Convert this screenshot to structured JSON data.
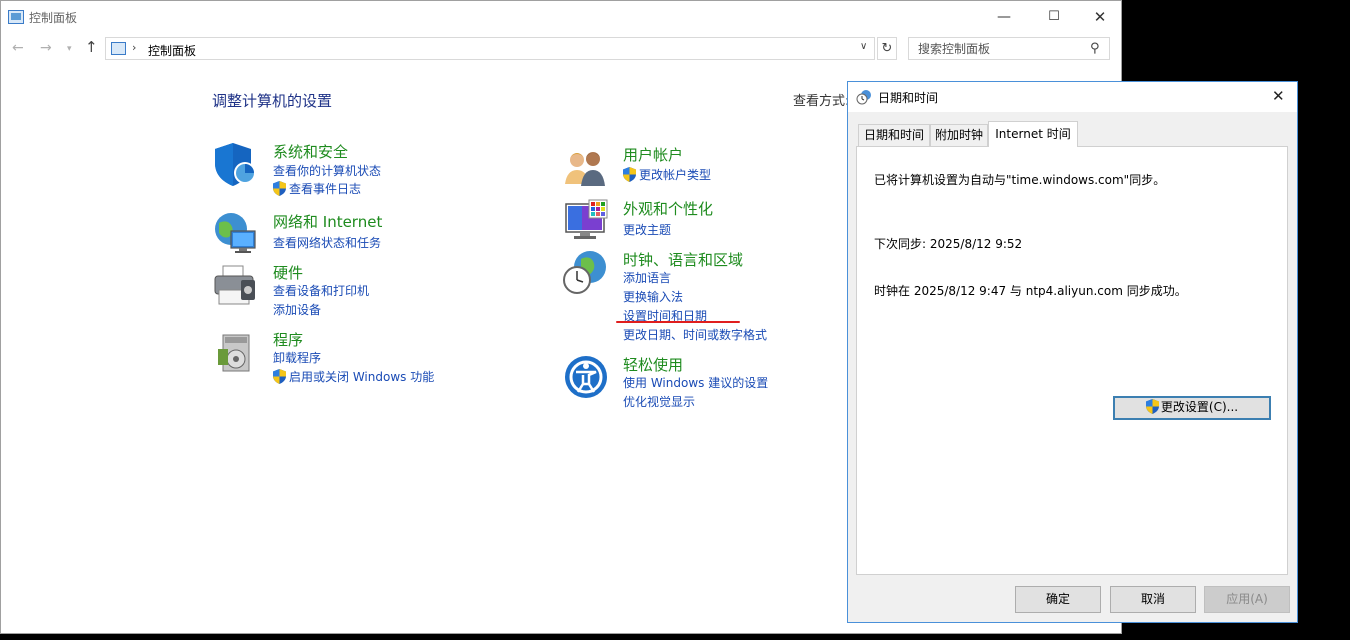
{
  "control_panel": {
    "window_title": "控制面板",
    "address": "控制面板",
    "search_placeholder": "搜索控制面板",
    "page_title": "调整计算机的设置",
    "view_by_label": "查看方式:",
    "categories": {
      "system_security": {
        "title": "系统和安全",
        "links": [
          "查看你的计算机状态",
          "查看事件日志"
        ]
      },
      "network": {
        "title": "网络和 Internet",
        "links": [
          "查看网络状态和任务"
        ]
      },
      "hardware": {
        "title": "硬件",
        "links": [
          "查看设备和打印机",
          "添加设备"
        ]
      },
      "programs": {
        "title": "程序",
        "links": [
          "卸载程序",
          "启用或关闭 Windows 功能"
        ]
      },
      "user_accounts": {
        "title": "用户帐户",
        "links": [
          "更改帐户类型"
        ]
      },
      "appearance": {
        "title": "外观和个性化",
        "links": [
          "更改主题"
        ]
      },
      "clock_region": {
        "title": "时钟、语言和区域",
        "links": [
          "添加语言",
          "更换输入法",
          "设置时间和日期",
          "更改日期、时间或数字格式"
        ]
      },
      "ease_of_access": {
        "title": "轻松使用",
        "links": [
          "使用 Windows 建议的设置",
          "优化视觉显示"
        ]
      }
    }
  },
  "dialog": {
    "title": "日期和时间",
    "tabs": [
      "日期和时间",
      "附加时钟",
      "Internet 时间"
    ],
    "active_tab": "Internet 时间",
    "sync_auto_text": "已将计算机设置为自动与\"time.windows.com\"同步。",
    "next_sync_text": "下次同步: 2025/8/12 9:52",
    "sync_result_text": "时钟在 2025/8/12 9:47 与 ntp4.aliyun.com 同步成功。",
    "change_settings_label": "更改设置(C)...",
    "ok_label": "确定",
    "cancel_label": "取消",
    "apply_label": "应用(A)"
  },
  "icons": {
    "close": "close-icon",
    "shield": "uac-shield-icon",
    "search": "search-icon"
  },
  "colors": {
    "category_title": "#1e8b1e",
    "link": "#1a4bb5",
    "page_title": "#1e3287",
    "annotation_red": "#e01e1e",
    "dialog_border": "#4a90d9"
  }
}
